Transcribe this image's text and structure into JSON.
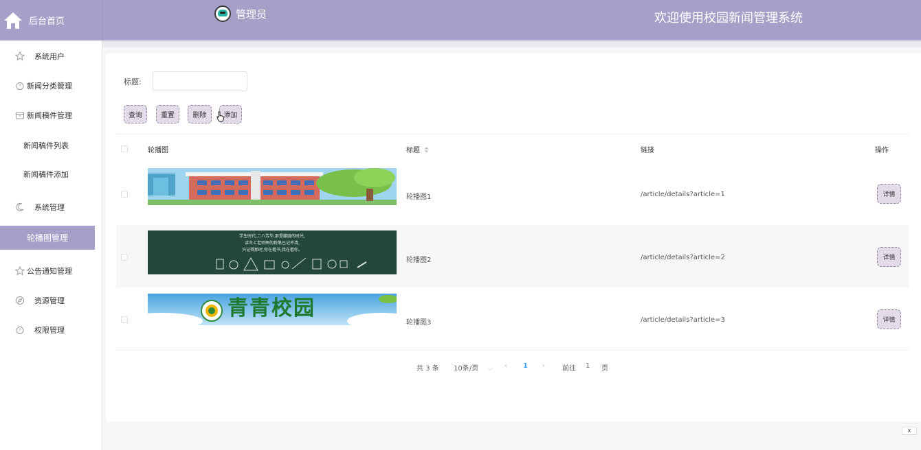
{
  "header": {
    "home_label": "后台首页",
    "user_name": "管理员",
    "site_title": "欢迎使用校园新闻管理系统"
  },
  "sidebar": {
    "items": [
      {
        "label": "系统用户",
        "icon": "star-icon"
      },
      {
        "label": "新闻分类管理",
        "icon": "timer-icon"
      },
      {
        "label": "新闻稿件管理",
        "icon": "box-icon"
      },
      {
        "label": "新闻稿件列表",
        "icon": ""
      },
      {
        "label": "新闻稿件添加",
        "icon": ""
      },
      {
        "label": "系统管理",
        "icon": "moon-icon"
      },
      {
        "label": "轮播图管理",
        "icon": "",
        "active": true
      },
      {
        "label": "公告通知管理",
        "icon": "star-icon"
      },
      {
        "label": "资源管理",
        "icon": "compass-icon"
      },
      {
        "label": "权限管理",
        "icon": "timer-icon"
      }
    ]
  },
  "search": {
    "title_label": "标题:",
    "title_value": ""
  },
  "toolbar": {
    "query": "查询",
    "reset": "重置",
    "delete": "删除",
    "add": "添加"
  },
  "table": {
    "headers": {
      "image": "轮播图",
      "title": "标题",
      "link": "链接",
      "action": "操作"
    },
    "rows": [
      {
        "title": "轮播图1",
        "link": "/article/details?article=1",
        "action": "详情"
      },
      {
        "title": "轮播图2",
        "link": "/article/details?article=2",
        "action": "详情",
        "banner_text": [
          "学生时代,二八芳华,那是朦胧的时光,",
          "讲台上老师挥的粉笔已记不清,",
          "只记得那时,你在看书,我在看你。"
        ]
      },
      {
        "title": "轮播图3",
        "link": "/article/details?article=3",
        "action": "详情",
        "banner_text": "青青校园"
      }
    ]
  },
  "pagination": {
    "total": "共 3 条",
    "page_size": "10条/页",
    "current": "1",
    "goto_label": "前往",
    "goto_value": "1",
    "page_suffix": "页"
  },
  "close_label": "x",
  "colors": {
    "header_bg": "#a6a0c9",
    "active_menu_bg": "#a6a0c9",
    "button_bg": "#e3dbe7",
    "pager_current": "#409eff"
  }
}
